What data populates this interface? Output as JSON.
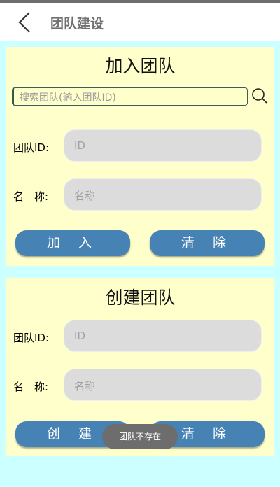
{
  "header": {
    "title": "团队建设"
  },
  "join": {
    "title": "加入团队",
    "search_placeholder": "搜索团队(输入团队ID)",
    "id_label": "团队ID:",
    "id_placeholder": "ID",
    "name_label": "名　称:",
    "name_placeholder": "名称",
    "join_button": "加 入",
    "clear_button": "清 除"
  },
  "create": {
    "title": "创建团队",
    "id_label": "团队ID:",
    "id_placeholder": "ID",
    "name_label": "名　称:",
    "name_placeholder": "名称",
    "create_button": "创 建",
    "clear_button": "清 除"
  },
  "toast": "团队不存在",
  "colors": {
    "background": "#ccffff",
    "card": "#ffffcc",
    "button": "#4682b4",
    "field": "#dcdcdc"
  }
}
